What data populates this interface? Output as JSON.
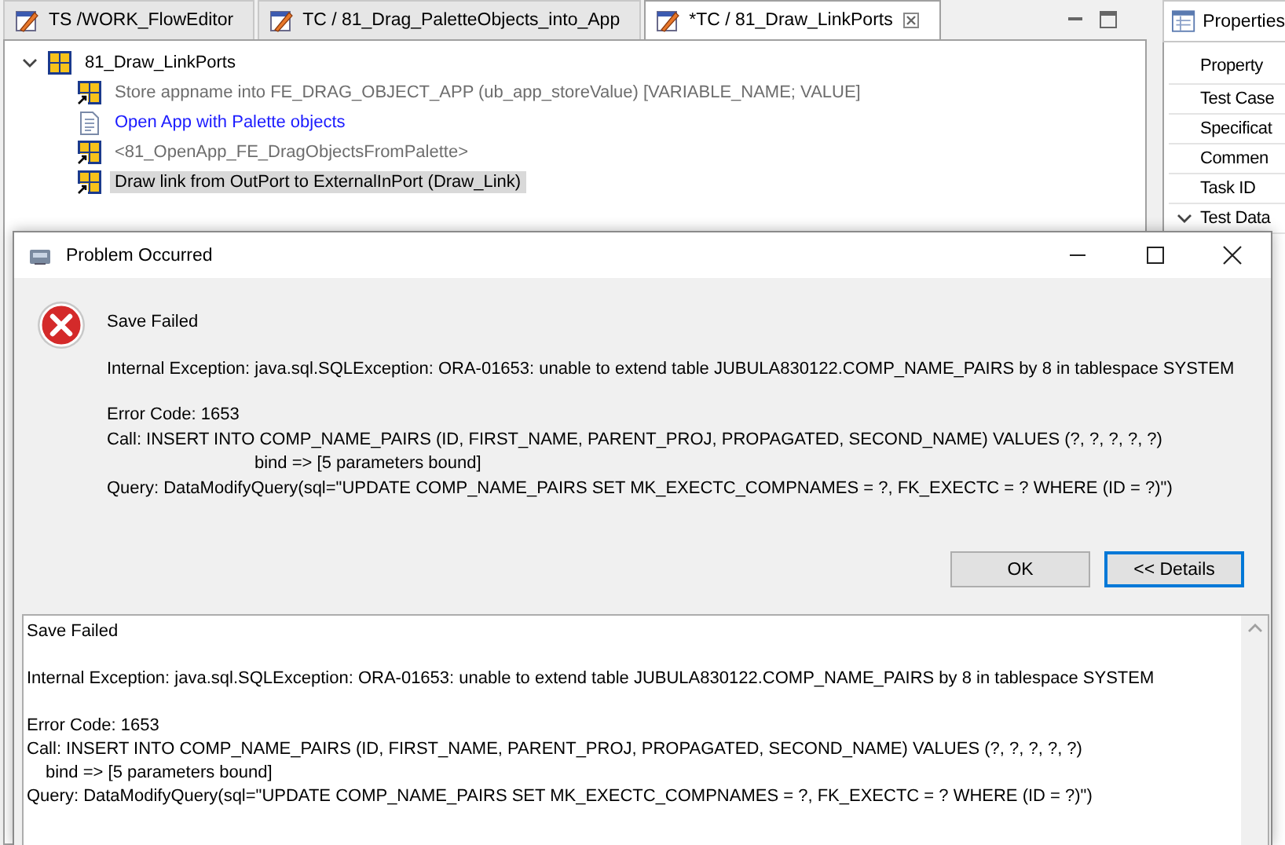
{
  "editor": {
    "tabs": [
      {
        "label": "TS /WORK_FlowEditor",
        "selected": false,
        "closable": false
      },
      {
        "label": "TC / 81_Drag_PaletteObjects_into_App",
        "selected": false,
        "closable": false
      },
      {
        "label": "*TC / 81_Draw_LinkPorts",
        "selected": true,
        "closable": true
      }
    ],
    "tree": {
      "label": "81_Draw_LinkPorts",
      "expanded": true,
      "children": [
        {
          "kind": "step",
          "label": "Store appname into FE_DRAG_OBJECT_APP (ub_app_storeValue) [VARIABLE_NAME; VALUE]",
          "selected": false
        },
        {
          "kind": "comment",
          "label": "Open App with Palette objects",
          "selected": false
        },
        {
          "kind": "reference",
          "label": "<81_OpenApp_FE_DragObjectsFromPalette>",
          "selected": false
        },
        {
          "kind": "step",
          "label": "Draw link from OutPort to ExternalInPort (Draw_Link)",
          "selected": true
        }
      ]
    }
  },
  "properties": {
    "title": "Properties",
    "rows": [
      {
        "kind": "header",
        "label": "Property"
      },
      {
        "kind": "row",
        "label": "Test Case"
      },
      {
        "kind": "row",
        "label": "Specificat"
      },
      {
        "kind": "row",
        "label": "Commen"
      },
      {
        "kind": "row",
        "label": "Task ID"
      },
      {
        "kind": "group",
        "label": "Test Data",
        "expanded": true
      }
    ]
  },
  "dialog": {
    "title": "Problem Occurred",
    "heading": "Save Failed",
    "paragraphs": [
      [
        {
          "text": "Internal Exception: java.sql.SQLException: ORA-01653: unable to extend table JUBULA830122.COMP_NAME_PAIRS by 8 in tablespace SYSTEM",
          "indented": false
        }
      ],
      [
        {
          "text": "Error Code: 1653",
          "indented": false
        },
        {
          "text": "Call: INSERT INTO COMP_NAME_PAIRS (ID, FIRST_NAME, PARENT_PROJ, PROPAGATED, SECOND_NAME) VALUES (?, ?, ?, ?, ?)",
          "indented": false
        },
        {
          "text": "bind => [5 parameters bound]",
          "indented": true
        },
        {
          "text": "Query: DataModifyQuery(sql=\"UPDATE COMP_NAME_PAIRS SET MK_EXECTC_COMPNAMES = ?, FK_EXECTC = ? WHERE (ID = ?)\")",
          "indented": false
        }
      ]
    ],
    "buttons": [
      {
        "label": "OK",
        "default": false
      },
      {
        "label": "<< Details",
        "default": true
      }
    ],
    "details": [
      [
        {
          "text": "Save Failed",
          "indented": false
        }
      ],
      [
        {
          "text": "Internal Exception: java.sql.SQLException: ORA-01653: unable to extend table JUBULA830122.COMP_NAME_PAIRS by 8 in tablespace SYSTEM",
          "indented": false
        }
      ],
      [
        {
          "text": "Error Code: 1653",
          "indented": false
        },
        {
          "text": "Call: INSERT INTO COMP_NAME_PAIRS (ID, FIRST_NAME, PARENT_PROJ, PROPAGATED, SECOND_NAME) VALUES (?, ?, ?, ?, ?)",
          "indented": false
        },
        {
          "text": "bind => [5 parameters bound]",
          "indented": true
        },
        {
          "text": "Query: DataModifyQuery(sql=\"UPDATE COMP_NAME_PAIRS SET MK_EXECTC_COMPNAMES = ?, FK_EXECTC = ? WHERE (ID = ?)\")",
          "indented": false
        }
      ]
    ]
  }
}
